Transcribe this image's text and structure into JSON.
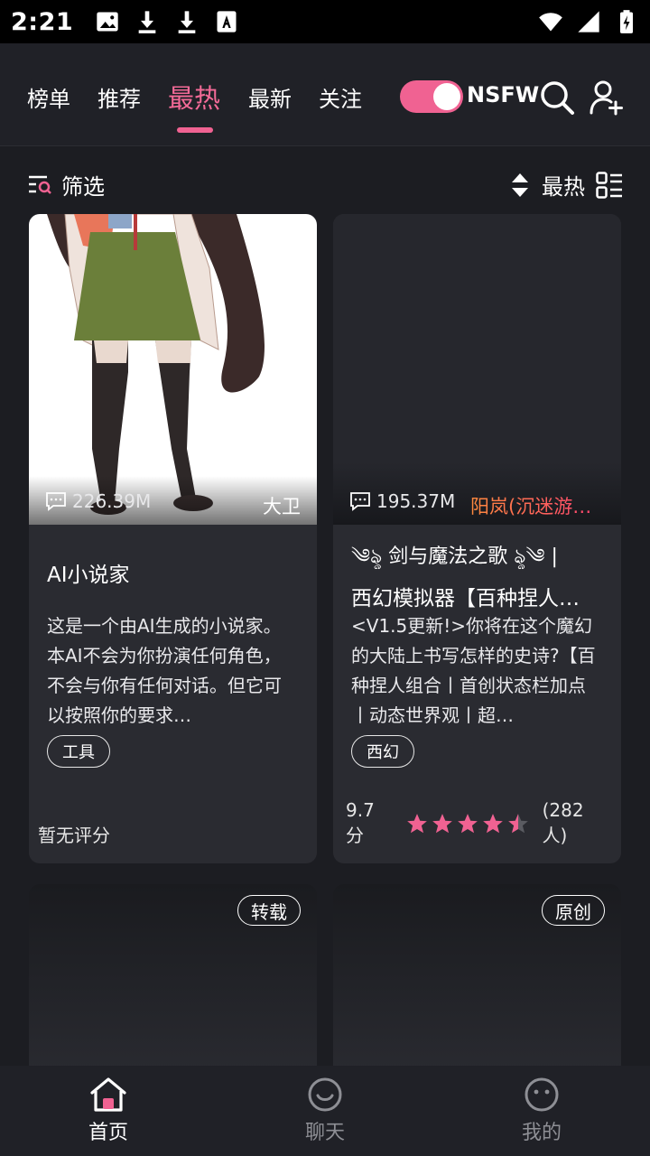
{
  "status_bar": {
    "time": "2:21",
    "left_icons": [
      "image-icon",
      "download-icon",
      "download-icon",
      "font-icon"
    ],
    "right_icons": [
      "wifi-icon",
      "signal-icon",
      "battery-charging-icon"
    ]
  },
  "top_nav": {
    "tabs": [
      {
        "label": "榜单",
        "active": false
      },
      {
        "label": "推荐",
        "active": false
      },
      {
        "label": "最热",
        "active": true
      },
      {
        "label": "最新",
        "active": false
      },
      {
        "label": "关注",
        "active": false
      }
    ],
    "nsfw_label": "NSFW",
    "nsfw_enabled": true,
    "accent_color": "#f06292"
  },
  "filter_bar": {
    "filter_label": "筛选",
    "sort_label": "最热"
  },
  "cards": [
    {
      "stats": "226.39M",
      "author": "大卫",
      "title": "AI小说家",
      "description": "这是一个由AI生成的小说家。本AI不会为你扮演任何角色，不会与你有任何对话。但它可以按照你的要求…",
      "tag": "工具",
      "rating_text": "暂无评分"
    },
    {
      "stats": "195.37M",
      "author": "阳岚(沉迷游…",
      "title_line1": "༄ৡ 剑与魔法之歌 ৡ༄ |",
      "title_line2": "西幻模拟器【百种捏人…",
      "description": "<V1.5更新!>你将在这个魔幻的大陆上书写怎样的史诗?【百种捏人组合丨首创状态栏加点丨动态世界观丨超…",
      "tag": "西幻",
      "score": "9.7分",
      "stars": 4.5,
      "count": "(282人)"
    },
    {
      "badge": "转载"
    },
    {
      "badge": "原创"
    }
  ],
  "bottom_nav": [
    {
      "label": "首页",
      "active": true
    },
    {
      "label": "聊天",
      "active": false
    },
    {
      "label": "我的",
      "active": false
    }
  ]
}
